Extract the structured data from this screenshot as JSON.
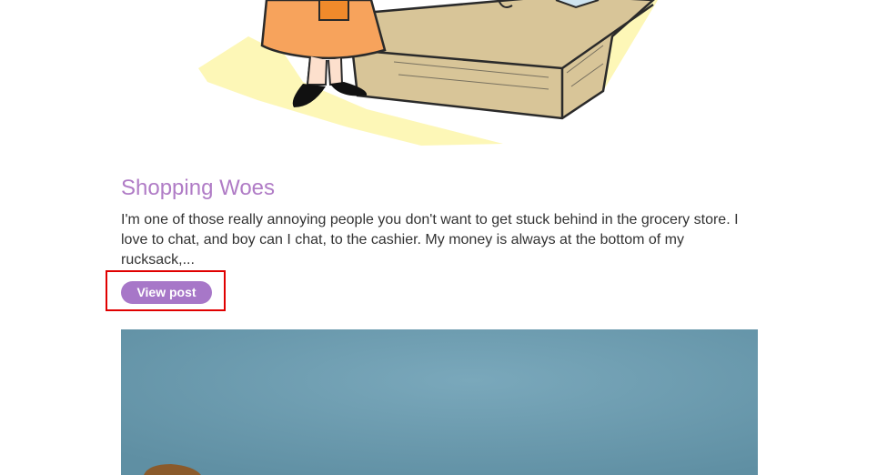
{
  "post": {
    "title": "Shopping Woes",
    "excerpt": "I'm one of those really annoying people you don't want to get stuck behind in the grocery store. I love to chat, and boy can I chat, to the cashier. My money is always at the bottom of my rucksack,...",
    "view_label": "View post"
  },
  "colors": {
    "title": "#b07cc6",
    "button": "#a777c8",
    "highlight": "#e00000",
    "next_image_bg": "#6a98ab"
  }
}
